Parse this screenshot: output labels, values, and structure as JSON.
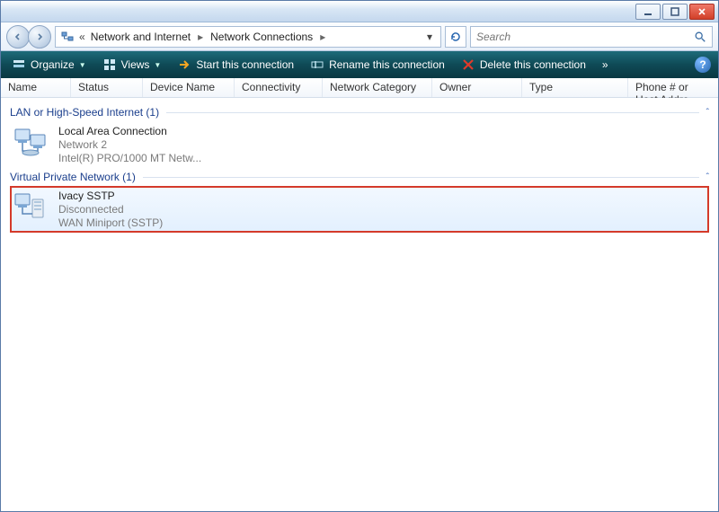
{
  "window": {
    "title": "Network Connections"
  },
  "breadcrumb": {
    "items": [
      "Network and Internet",
      "Network Connections"
    ]
  },
  "search": {
    "placeholder": "Search"
  },
  "toolbar": {
    "organize": "Organize",
    "views": "Views",
    "start": "Start this connection",
    "rename": "Rename this connection",
    "delete": "Delete this connection",
    "more": "»"
  },
  "columns": {
    "name": "Name",
    "status": "Status",
    "device": "Device Name",
    "connectivity": "Connectivity",
    "category": "Network Category",
    "owner": "Owner",
    "type": "Type",
    "phone": "Phone # or Host Addre..."
  },
  "groups": [
    {
      "label": "LAN or High-Speed Internet (1)",
      "items": [
        {
          "title": "Local Area Connection",
          "sub1": "Network  2",
          "sub2": "Intel(R) PRO/1000 MT Netw..."
        }
      ]
    },
    {
      "label": "Virtual Private Network (1)",
      "items": [
        {
          "title": "Ivacy SSTP",
          "sub1": "Disconnected",
          "sub2": "WAN Miniport (SSTP)",
          "selected": true
        }
      ]
    }
  ]
}
